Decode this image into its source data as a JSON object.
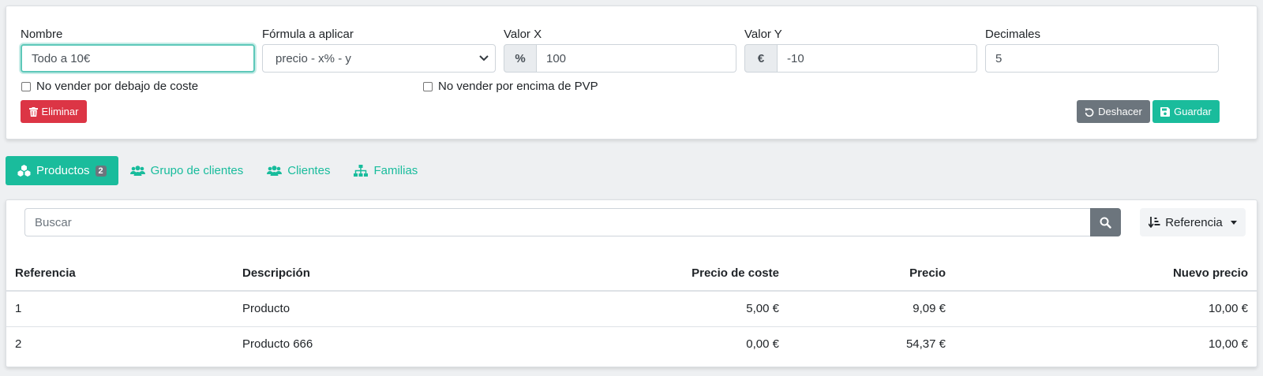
{
  "form": {
    "nombre_label": "Nombre",
    "nombre_value": "Todo a 10€",
    "formula_label": "Fórmula a aplicar",
    "formula_value": "precio - x% - y",
    "valor_x_label": "Valor X",
    "valor_x_addon": "%",
    "valor_x_value": "100",
    "valor_y_label": "Valor Y",
    "valor_y_addon": "€",
    "valor_y_value": "-10",
    "decimales_label": "Decimales",
    "decimales_value": "5",
    "no_below_cost_label": "No vender por debajo de coste",
    "no_above_pvp_label": "No vender por encima de PVP"
  },
  "buttons": {
    "delete": "Eliminar",
    "undo": "Deshacer",
    "save": "Guardar"
  },
  "tabs": [
    {
      "label": "Productos",
      "badge": "2"
    },
    {
      "label": "Grupo de clientes"
    },
    {
      "label": "Clientes"
    },
    {
      "label": "Familias"
    }
  ],
  "search": {
    "placeholder": "Buscar",
    "sort_label": "Referencia"
  },
  "table": {
    "headers": [
      "Referencia",
      "Descripción",
      "Precio de coste",
      "Precio",
      "Nuevo precio"
    ],
    "rows": [
      [
        "1",
        "Producto",
        "5,00 €",
        "9,09 €",
        "10,00 €"
      ],
      [
        "2",
        "Producto 666",
        "0,00 €",
        "54,37 €",
        "10,00 €"
      ]
    ]
  },
  "colors": {
    "accent": "#1abc9c",
    "danger": "#dc3545",
    "secondary": "#6c757d"
  }
}
